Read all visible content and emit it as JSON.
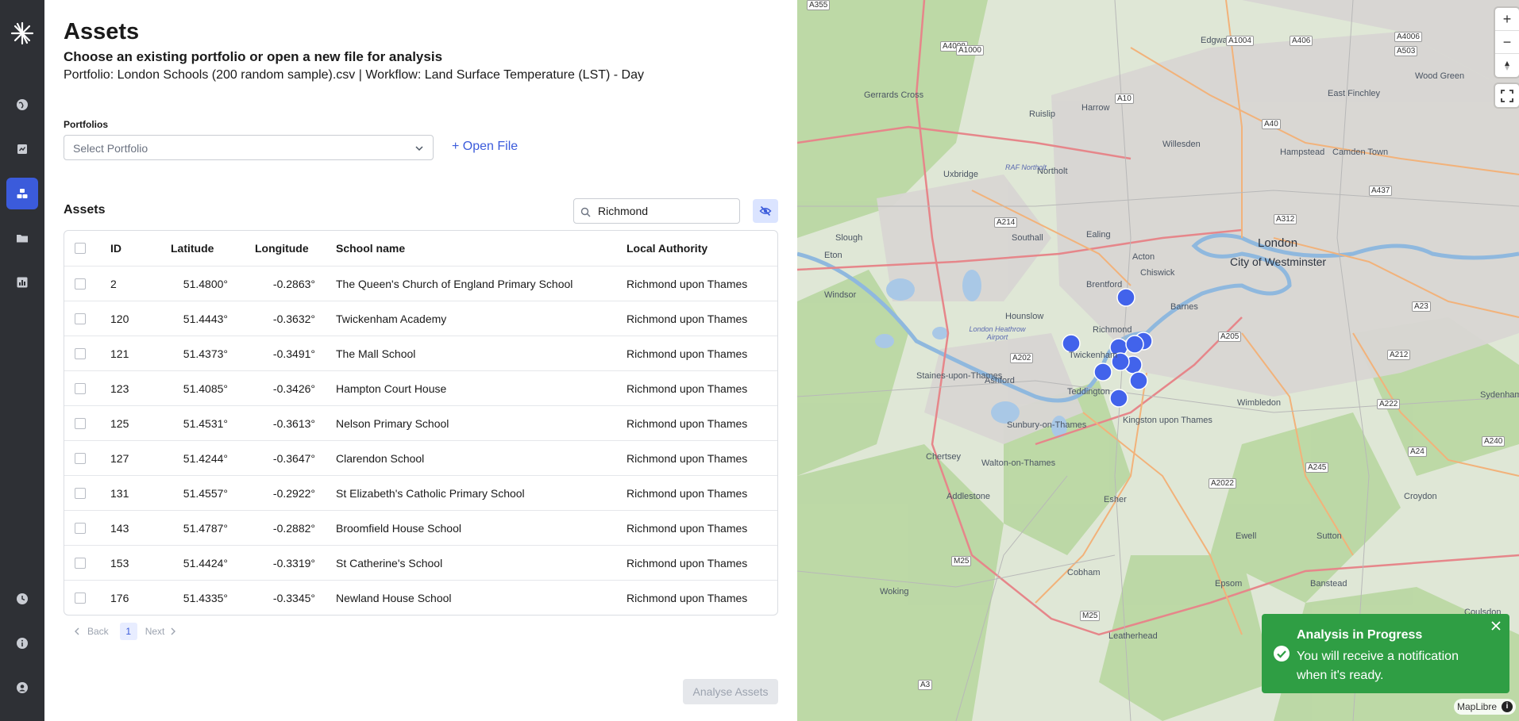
{
  "sidebar": {
    "items": [
      {
        "name": "globe-icon"
      },
      {
        "name": "report-icon"
      },
      {
        "name": "assets-icon",
        "active": true
      },
      {
        "name": "folder-icon"
      },
      {
        "name": "chart-icon"
      },
      {
        "name": "history-icon"
      },
      {
        "name": "info-icon"
      },
      {
        "name": "user-icon"
      }
    ]
  },
  "header": {
    "title": "Assets",
    "subtitle": "Choose an existing portfolio or open a new file for analysis",
    "portfolio_line": "Portfolio: London Schools (200 random sample).csv | Workflow: Land Surface Temperature (LST) - Day"
  },
  "portfolios": {
    "label": "Portfolios",
    "placeholder": "Select Portfolio",
    "open_file": "+ Open File"
  },
  "assets": {
    "title": "Assets",
    "search_value": "Richmond",
    "columns": [
      "ID",
      "Latitude",
      "Longitude",
      "School name",
      "Local Authority"
    ],
    "rows": [
      {
        "id": "2",
        "lat": "51.4800°",
        "lon": "-0.2863°",
        "name": "The Queen's Church of England Primary School",
        "la": "Richmond upon Thames"
      },
      {
        "id": "120",
        "lat": "51.4443°",
        "lon": "-0.3632°",
        "name": "Twickenham Academy",
        "la": "Richmond upon Thames"
      },
      {
        "id": "121",
        "lat": "51.4373°",
        "lon": "-0.3491°",
        "name": "The Mall School",
        "la": "Richmond upon Thames"
      },
      {
        "id": "123",
        "lat": "51.4085°",
        "lon": "-0.3426°",
        "name": "Hampton Court House",
        "la": "Richmond upon Thames"
      },
      {
        "id": "125",
        "lat": "51.4531°",
        "lon": "-0.3613°",
        "name": "Nelson Primary School",
        "la": "Richmond upon Thames"
      },
      {
        "id": "127",
        "lat": "51.4244°",
        "lon": "-0.3647°",
        "name": "Clarendon School",
        "la": "Richmond upon Thames"
      },
      {
        "id": "131",
        "lat": "51.4557°",
        "lon": "-0.2922°",
        "name": "St Elizabeth's Catholic Primary School",
        "la": "Richmond upon Thames"
      },
      {
        "id": "143",
        "lat": "51.4787°",
        "lon": "-0.2882°",
        "name": "Broomfield House School",
        "la": "Richmond upon Thames"
      },
      {
        "id": "153",
        "lat": "51.4424°",
        "lon": "-0.3319°",
        "name": "St Catherine's School",
        "la": "Richmond upon Thames"
      },
      {
        "id": "176",
        "lat": "51.4335°",
        "lon": "-0.3345°",
        "name": "Newland House School",
        "la": "Richmond upon Thames"
      }
    ]
  },
  "pagination": {
    "back": "Back",
    "page": "1",
    "next": "Next"
  },
  "actions": {
    "analyse": "Analyse Assets"
  },
  "map": {
    "labels": {
      "london": "London",
      "westminster": "City of Westminster",
      "richmond": "Richmond",
      "twickenham": "Twickenham",
      "teddington": "Teddington",
      "hounslow": "Hounslow",
      "brentford": "Brentford",
      "chiswick": "Chiswick",
      "barnes": "Barnes",
      "ealing": "Ealing",
      "acton": "Acton",
      "southall": "Southall",
      "northolt": "Northolt",
      "harrow": "Harrow",
      "edgware": "Edgware",
      "ruislip": "Ruislip",
      "uxbridge": "Uxbridge",
      "gerrards_cross": "Gerrards Cross",
      "slough": "Slough",
      "windsor": "Windsor",
      "eton": "Eton",
      "staines": "Staines-upon-Thames",
      "ashford": "Ashford",
      "sunbury": "Sunbury-on-Thames",
      "kingston": "Kingston upon Thames",
      "wimbledon": "Wimbledon",
      "walton": "Walton-on-Thames",
      "chertsey": "Chertsey",
      "addlestone": "Addlestone",
      "esher": "Esher",
      "cobham": "Cobham",
      "woking": "Woking",
      "epsom": "Epsom",
      "ewell": "Ewell",
      "sutton": "Sutton",
      "croydon": "Croydon",
      "leatherhead": "Leatherhead",
      "banstead": "Banstead",
      "hampstead": "Hampstead",
      "willesden": "Willesden",
      "camden": "Camden Town",
      "east_finchley": "East Finchley",
      "wood_green": "Wood Green",
      "sydenham": "Sydenham",
      "heathrow": "London Heathrow Airport",
      "raf_northolt": "RAF Northolt",
      "coulsdon": "Coulsdon"
    },
    "road_labels": [
      "A4008",
      "A1000",
      "A1004",
      "A406",
      "A4006",
      "A503",
      "A10",
      "A40",
      "A437",
      "A312",
      "A214",
      "A202",
      "A205",
      "A23",
      "A212",
      "A222",
      "A24",
      "A240",
      "A245",
      "A2022",
      "M25",
      "M25",
      "A3",
      "A355"
    ],
    "markers_count": 10,
    "attribution": "MapLibre",
    "accent": "#4263eb"
  },
  "toast": {
    "title": "Analysis in Progress",
    "message": "You will receive a notification when it's ready.",
    "color": "#2f9e44"
  }
}
